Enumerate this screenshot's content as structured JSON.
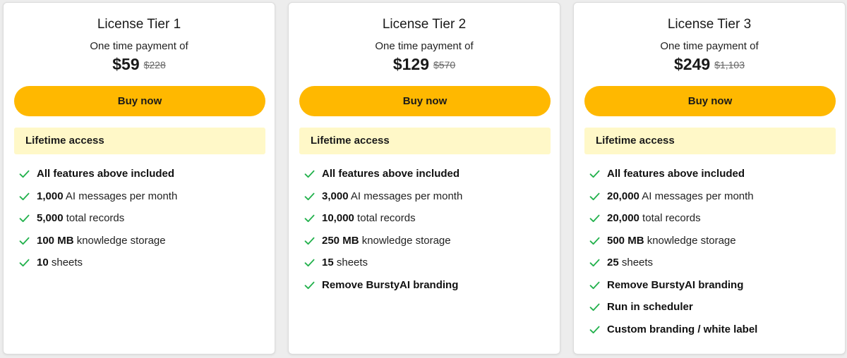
{
  "colors": {
    "button": "#ffb800",
    "access_bg": "#fff8c8",
    "check": "#22b14c"
  },
  "tiers": [
    {
      "title": "License Tier 1",
      "subtitle": "One time payment of",
      "price": "$59",
      "old_price": "$228",
      "button": "Buy now",
      "access": "Lifetime access",
      "features": [
        {
          "bold": "All features above included",
          "text": ""
        },
        {
          "bold": "1,000",
          "text": " AI messages per month"
        },
        {
          "bold": "5,000",
          "text": " total records"
        },
        {
          "bold": "100 MB",
          "text": " knowledge storage"
        },
        {
          "bold": "10",
          "text": " sheets"
        }
      ]
    },
    {
      "title": "License Tier 2",
      "subtitle": "One time payment of",
      "price": "$129",
      "old_price": "$570",
      "button": "Buy now",
      "access": "Lifetime access",
      "features": [
        {
          "bold": "All features above included",
          "text": ""
        },
        {
          "bold": "3,000",
          "text": " AI messages per month"
        },
        {
          "bold": "10,000",
          "text": " total records"
        },
        {
          "bold": "250 MB",
          "text": " knowledge storage"
        },
        {
          "bold": "15",
          "text": " sheets"
        },
        {
          "bold": "Remove BurstyAI branding",
          "text": ""
        }
      ]
    },
    {
      "title": "License Tier 3",
      "subtitle": "One time payment of",
      "price": "$249",
      "old_price": "$1,103",
      "button": "Buy now",
      "access": "Lifetime access",
      "features": [
        {
          "bold": "All features above included",
          "text": ""
        },
        {
          "bold": "20,000",
          "text": " AI messages per month"
        },
        {
          "bold": "20,000",
          "text": " total records"
        },
        {
          "bold": "500 MB",
          "text": " knowledge storage"
        },
        {
          "bold": "25",
          "text": " sheets"
        },
        {
          "bold": "Remove BurstyAI branding",
          "text": ""
        },
        {
          "bold": "Run in scheduler",
          "text": ""
        },
        {
          "bold": "Custom branding / white label",
          "text": ""
        }
      ]
    }
  ]
}
